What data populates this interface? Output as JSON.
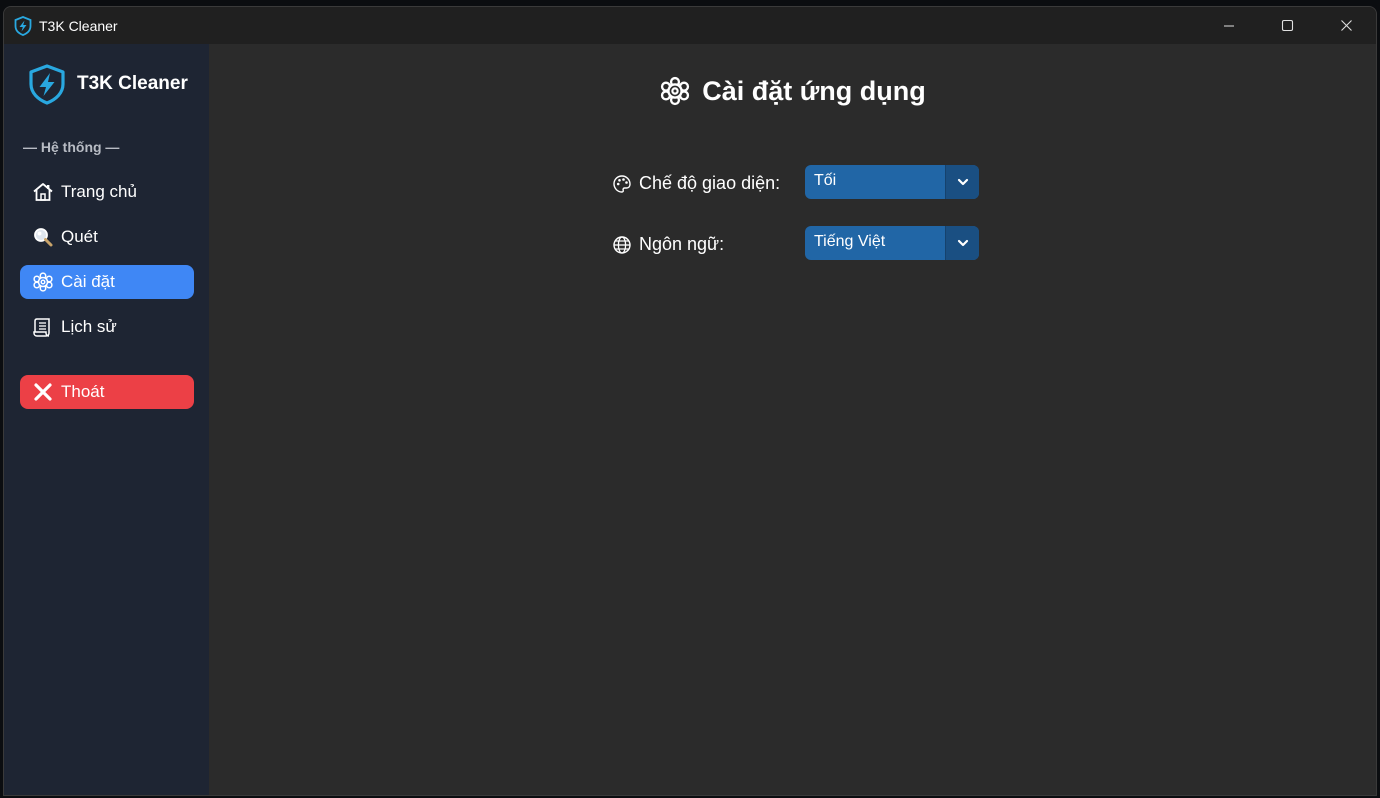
{
  "window": {
    "title": "T3K Cleaner"
  },
  "sidebar": {
    "brand": "T3K Cleaner",
    "section_label": "— Hệ thống —",
    "items": [
      {
        "label": "Trang chủ",
        "icon": "home-icon"
      },
      {
        "label": "Quét",
        "icon": "magnifier-icon"
      },
      {
        "label": "Cài đặt",
        "icon": "gear-icon",
        "active": true
      },
      {
        "label": "Lịch sử",
        "icon": "scroll-icon"
      }
    ],
    "exit": {
      "label": "Thoát",
      "icon": "close-x-icon"
    }
  },
  "main": {
    "title": "Cài đặt ứng dụng",
    "settings": [
      {
        "label": "Chế độ giao diện:",
        "icon": "palette-icon",
        "value": "Tối"
      },
      {
        "label": "Ngôn ngữ:",
        "icon": "globe-icon",
        "value": "Tiếng Việt"
      }
    ]
  },
  "colors": {
    "sidebar_bg": "#1e2533",
    "main_bg": "#2b2b2b",
    "titlebar_bg": "#202020",
    "active_item": "#3f87f5",
    "exit_button": "#ec4046",
    "combo_bg": "#2166a6",
    "accent_cyan": "#29a8e0"
  }
}
